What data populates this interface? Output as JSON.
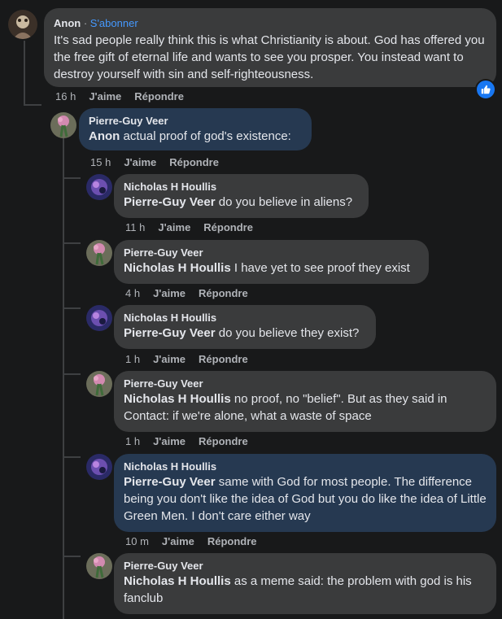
{
  "comments": [
    {
      "author": "Anon",
      "follow": "S'abonner",
      "text": "It's sad people really think this is what Christianity is about. God has offered you the free gift of eternal life and wants to see you prosper. You instead want to destroy yourself with sin and self-righteousness.",
      "time": "16 h",
      "like": "J'aime",
      "reply": "Répondre",
      "reaction_icon": "like-icon"
    },
    {
      "author": "Pierre-Guy Veer",
      "mention": "Anon",
      "text": "actual proof of god's existence:",
      "time": "15 h",
      "like": "J'aime",
      "reply": "Répondre"
    },
    {
      "author": "Nicholas H Houllis",
      "mention": "Pierre-Guy Veer",
      "text": "do you believe in aliens?",
      "time": "11 h",
      "like": "J'aime",
      "reply": "Répondre"
    },
    {
      "author": "Pierre-Guy Veer",
      "mention": "Nicholas H Houllis",
      "text": "I have yet to see proof they exist",
      "time": "4 h",
      "like": "J'aime",
      "reply": "Répondre"
    },
    {
      "author": "Nicholas H Houllis",
      "mention": "Pierre-Guy Veer",
      "text": "do you believe they exist?",
      "time": "1 h",
      "like": "J'aime",
      "reply": "Répondre"
    },
    {
      "author": "Pierre-Guy Veer",
      "mention": "Nicholas H Houllis",
      "text": "no proof, no \"belief\". But as they said in Contact: if we're alone, what a waste of space",
      "time": "1 h",
      "like": "J'aime",
      "reply": "Répondre"
    },
    {
      "author": "Nicholas H Houllis",
      "mention": "Pierre-Guy Veer",
      "text": "same with God for most people. The difference being you don't like the idea of God but you do like the idea of Little Green Men. I don't care either way",
      "time": "10 m",
      "like": "J'aime",
      "reply": "Répondre"
    },
    {
      "author": "Pierre-Guy Veer",
      "mention": "Nicholas H Houllis",
      "text": "as a meme said: the problem with god is his fanclub",
      "time": "",
      "like": "",
      "reply": ""
    }
  ],
  "colors": {
    "background": "#18191a",
    "bubble": "#3a3b3c",
    "bubble_highlight": "#263951",
    "link": "#4599ff",
    "like_blue": "#1877f2"
  }
}
